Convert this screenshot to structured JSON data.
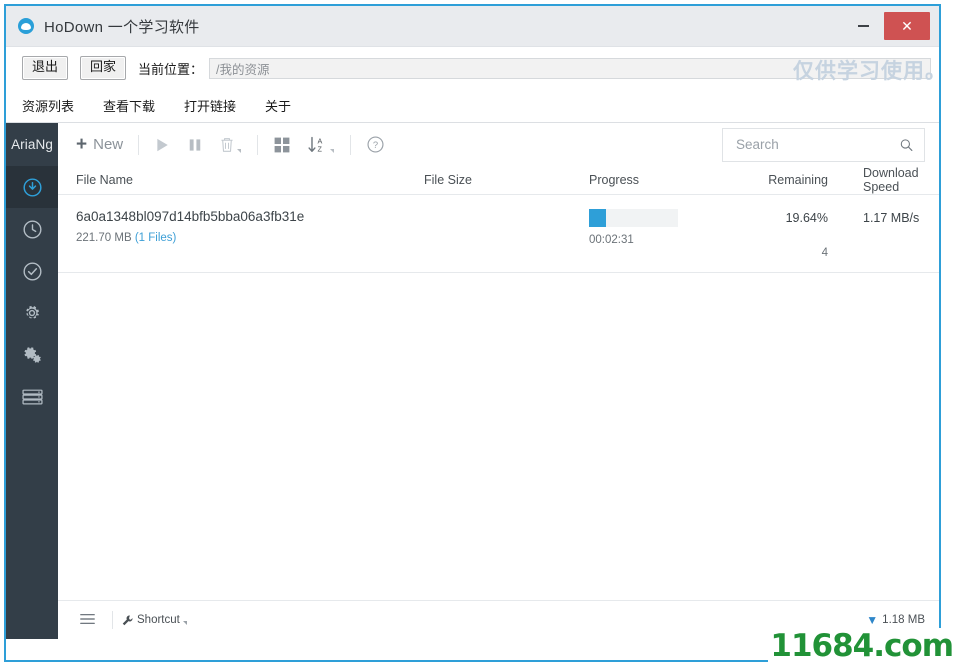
{
  "window": {
    "title": "HoDown  一个学习软件",
    "app_icon": "hodown-logo-icon",
    "minimize_label": "−",
    "close_label": "✕",
    "accent_border": "#2e9fd8",
    "titlebar_bg": "#e9ebee",
    "close_bg": "#cf5252"
  },
  "chrome": {
    "exit_button": "退出",
    "home_button": "回家",
    "path_label": "当前位置：",
    "path_value": "/我的资源",
    "nav": [
      {
        "label": "资源列表"
      },
      {
        "label": "查看下载"
      },
      {
        "label": "打开链接"
      },
      {
        "label": "关于"
      }
    ]
  },
  "ariang": {
    "brand": "AriaNg",
    "sidebar": [
      {
        "name": "downloading",
        "icon": "download-clock-icon",
        "active": true
      },
      {
        "name": "waiting",
        "icon": "clock-icon",
        "active": false
      },
      {
        "name": "finished",
        "icon": "check-circle-icon",
        "active": false
      },
      {
        "name": "settings",
        "icon": "gear-icon",
        "active": false
      },
      {
        "name": "ariang-settings",
        "icon": "gears-icon",
        "active": false
      },
      {
        "name": "aria2-status",
        "icon": "server-icon",
        "active": false
      }
    ],
    "toolbar": {
      "new_label": "New",
      "new_icon": "plus-icon",
      "start_icon": "play-icon",
      "pause_icon": "pause-icon",
      "delete_icon": "trash-icon",
      "layout_icon": "grid-icon",
      "sort_icon": "sort-alpha-down-icon",
      "help_icon": "question-circle-icon"
    },
    "search": {
      "placeholder": "Search",
      "value": "",
      "icon": "search-icon"
    },
    "table": {
      "columns": [
        "File Name",
        "File Size",
        "Progress",
        "Remaining",
        "Download Speed"
      ],
      "rows": [
        {
          "file_name": "6a0a1348bl097d14bfb5bba06a3fb31e",
          "size_text": "221.70 MB",
          "files_text": "(1 Files)",
          "file_size": "",
          "progress_percent": "19.64%",
          "progress_value": 19.64,
          "progress_color": "#2e9fd8",
          "elapsed": "00:02:31",
          "remaining": "",
          "remaining_sub": "4",
          "download_speed": "1.17 MB/s"
        }
      ]
    },
    "status": {
      "menu_icon": "hamburger-icon",
      "shortcut_icon": "wrench-icon",
      "shortcut_label": "Shortcut",
      "download_icon": "arrow-down-icon",
      "global_download_speed": "1.18 MB"
    }
  },
  "watermarks": {
    "top": "仅供学习使用。",
    "bottom": "11684.com"
  }
}
